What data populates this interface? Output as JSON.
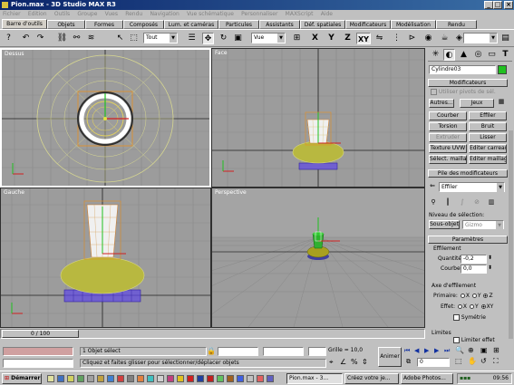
{
  "window": {
    "title": "Pion.max - 3D Studio MAX R3"
  },
  "menu": [
    "Fichier",
    "Edition",
    "Outils",
    "Groupe",
    "Vues",
    "Rendu",
    "Navigation",
    "Vue schématique",
    "Personnaliser",
    "MAXScript",
    "Aide"
  ],
  "tabs": [
    {
      "label": "Barre d'outils",
      "active": true
    },
    {
      "label": "Objets"
    },
    {
      "label": "Formes"
    },
    {
      "label": "Composés"
    },
    {
      "label": "Lum. et caméras"
    },
    {
      "label": "Particules"
    },
    {
      "label": "Assistants"
    },
    {
      "label": "Déf. spatiales"
    },
    {
      "label": "Modificateurs"
    },
    {
      "label": "Modélisation"
    },
    {
      "label": "Rendu"
    }
  ],
  "toolbar": {
    "selection_filter": "Tout",
    "ref_coord": "Vue",
    "axis_x": "X",
    "axis_y": "Y",
    "axis_z": "Z",
    "axis_xy": "XY",
    "named_selection": ""
  },
  "viewports": {
    "top": "Dessus",
    "front": "Face",
    "left": "Gauche",
    "perspective": "Perspective"
  },
  "panel": {
    "object_name": "Cylindre03",
    "object_color": "#20c020",
    "modifiers_header": "Modificateurs",
    "use_pivot": "Utiliser pivots de sél.",
    "btn_others": "Autres...",
    "btn_sets": "Jeux",
    "mod_buttons": [
      "Courber",
      "Effiler",
      "Torsion",
      "Bruit",
      "Extruder",
      "Lisser",
      "Texture UVW",
      "Editer carreau",
      "Sélect. maillage",
      "Editer maillage"
    ],
    "stack_header": "Pile des modificateurs",
    "stack_value": "Effiler",
    "sel_level_label": "Niveau de sélection:",
    "subobj_btn": "Sous-objet",
    "subobj_value": "Gizmo",
    "params_header": "Paramètres",
    "taper_label": "Effilement",
    "amount_label": "Quantité:",
    "amount_value": "-0,2",
    "curve_label": "Courbe:",
    "curve_value": "0,0",
    "axis_group": "Axe d'effilement",
    "primary_label": "Primaire:",
    "effect_label": "Effet:",
    "radio_x": "X",
    "radio_y": "Y",
    "radio_z": "Z",
    "radio_xy": "XY",
    "symmetry_label": "Symétrie",
    "limits_label": "Limites",
    "limit_effect": "Limiter effet"
  },
  "timeline": {
    "frame_display": "0 / 100"
  },
  "status": {
    "selection_info": "1 Objet sélect",
    "prompt": "Cliquez et faites glisser pour sélectionner/déplacer objets",
    "grid": "Grille = 10,0",
    "animate": "Animer",
    "frame": "0"
  },
  "taskbar": {
    "start": "Démarrer",
    "tasks": [
      "Pion.max - 3...",
      "Créez votre je...",
      "Adobe Photos..."
    ],
    "clock": "09:56"
  }
}
